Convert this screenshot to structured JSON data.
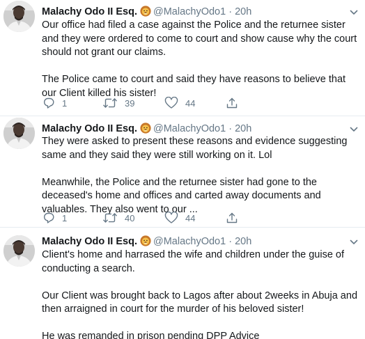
{
  "tweets": [
    {
      "name": "Malachy Odo II Esq.",
      "handle": "@MalachyOdo1",
      "separator": "·",
      "time": "20h",
      "paragraphs": [
        "Our office had filed a case against the Police and the returnee sister and they were ordered to come to court and show cause why the court should not grant our claims.",
        "The Police came to court and said they have reasons to believe that our Client killed his sister!"
      ],
      "replies": "1",
      "retweets": "39",
      "likes": "44"
    },
    {
      "name": "Malachy Odo II Esq.",
      "handle": "@MalachyOdo1",
      "separator": "·",
      "time": "20h",
      "paragraphs": [
        "They were asked to present these reasons and evidence suggesting same and they said they were still working on it. Lol",
        "Meanwhile, the Police and the returnee sister had gone to the deceased's home and offices and carted away documents and valuables. They also went to our ..."
      ],
      "replies": "1",
      "retweets": "40",
      "likes": "44"
    },
    {
      "name": "Malachy Odo II Esq.",
      "handle": "@MalachyOdo1",
      "separator": "·",
      "time": "20h",
      "paragraphs": [
        "Client's home and harrased the wife and children under the guise of conducting a search.",
        "Our Client was brought back to Lagos after about 2weeks in Abuja and then arraigned in court for the murder of his beloved sister!",
        "He was remanded in prison pending DPP Advice"
      ]
    }
  ],
  "icons": {
    "avatar": "avatar-photo",
    "badge": "lion-emoji",
    "caret": "chevron-down-icon",
    "reply": "reply-icon",
    "retweet": "retweet-icon",
    "like": "heart-icon",
    "share": "share-icon"
  },
  "colors": {
    "text": "#14171a",
    "secondary": "#657786",
    "divider": "#e6ecf0"
  }
}
